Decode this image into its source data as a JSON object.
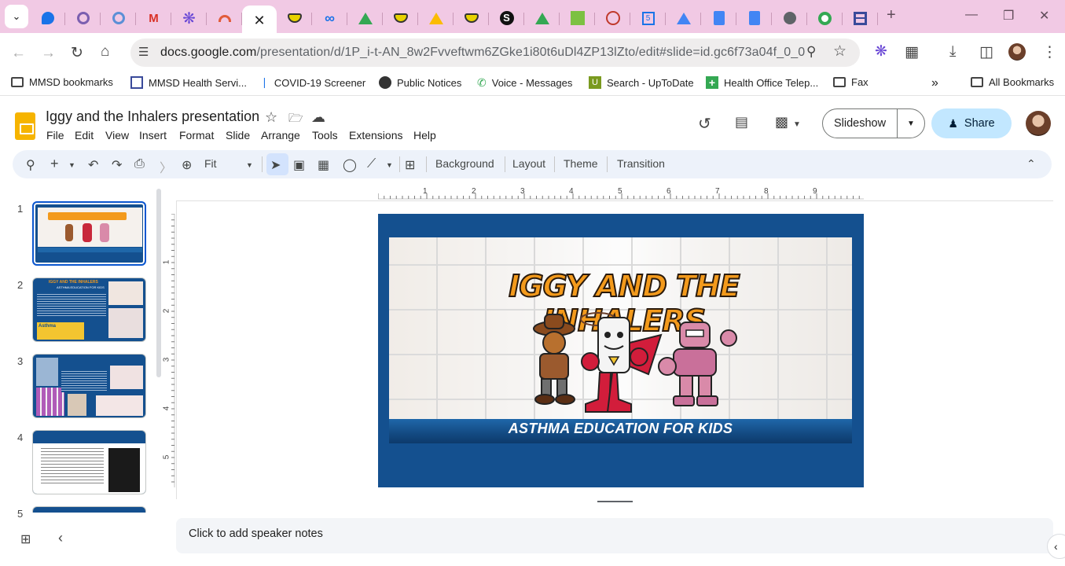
{
  "browser": {
    "tabs": [
      {
        "icon": "edge-blue-icon",
        "color": "#1a73e8"
      },
      {
        "icon": "target-icon",
        "color": "#7b5fb0"
      },
      {
        "icon": "target-icon",
        "color": "#5b8fd6"
      },
      {
        "icon": "gmail-icon",
        "color": "#d93025"
      },
      {
        "icon": "asterisk-icon",
        "color": "#6c4ad6"
      },
      {
        "icon": "rainbow-icon",
        "color": "#e25b3a"
      },
      {
        "icon": "close-icon",
        "color": "#1f1f1f",
        "active": true
      },
      {
        "icon": "mask-icon",
        "color": "#e8d200"
      },
      {
        "icon": "infinity-icon",
        "color": "#1a73e8"
      },
      {
        "icon": "drive-icon",
        "color": "#34a853"
      },
      {
        "icon": "mask-icon",
        "color": "#e8d200"
      },
      {
        "icon": "drive-icon",
        "color": "#34a853"
      },
      {
        "icon": "mask-icon",
        "color": "#e8d200"
      },
      {
        "icon": "s-icon",
        "color": "#1f1f1f"
      },
      {
        "icon": "drive-icon",
        "color": "#34a853"
      },
      {
        "icon": "green-square-icon",
        "color": "#7cc142"
      },
      {
        "icon": "crosshair-icon",
        "color": "#c0392b"
      },
      {
        "icon": "calendar-icon",
        "color": "#1a73e8"
      },
      {
        "icon": "drive-icon",
        "color": "#34a853"
      },
      {
        "icon": "docs-icon",
        "color": "#4285f4"
      },
      {
        "icon": "docs-icon",
        "color": "#4285f4"
      },
      {
        "icon": "globe-icon",
        "color": "#5f6368"
      },
      {
        "icon": "chrome-icon",
        "color": "#34a853"
      },
      {
        "icon": "table-icon",
        "color": "#3a4a9a"
      }
    ],
    "url_domain": "docs.google.com",
    "url_path": "/presentation/d/1P_i-t-AN_8w2Fvveftwm6ZGke1i80t6uDl4ZP13lZto/edit#slide=id.gc6f73a04f_0_0",
    "bookmarks": [
      {
        "label": "MMSD bookmarks",
        "icon": "folder-icon"
      },
      {
        "label": "MMSD Health Servi...",
        "icon": "calendar-icon"
      },
      {
        "label": "COVID-19 Screener",
        "icon": "pin-icon"
      },
      {
        "label": "Public Notices",
        "icon": "globe-icon"
      },
      {
        "label": "Voice - Messages",
        "icon": "phone-icon"
      },
      {
        "label": "Search - UpToDate",
        "icon": "uptodate-icon"
      },
      {
        "label": "Health Office Telep...",
        "icon": "plus-icon"
      },
      {
        "label": "Fax",
        "icon": "folder-icon"
      }
    ],
    "all_bookmarks": "All Bookmarks"
  },
  "doc": {
    "title": "Iggy and the Inhalers presentation",
    "menu": [
      "File",
      "Edit",
      "View",
      "Insert",
      "Format",
      "Slide",
      "Arrange",
      "Tools",
      "Extensions",
      "Help"
    ],
    "slideshow_label": "Slideshow",
    "share_label": "Share"
  },
  "toolbar": {
    "zoom": "Fit",
    "background": "Background",
    "layout": "Layout",
    "theme": "Theme",
    "transition": "Transition"
  },
  "filmstrip": {
    "slides": [
      "1",
      "2",
      "3",
      "4",
      "5"
    ]
  },
  "rulers": {
    "h": [
      "1",
      "2",
      "3",
      "4",
      "5",
      "6",
      "7",
      "8",
      "9"
    ],
    "v": [
      "1",
      "2",
      "3",
      "4",
      "5"
    ]
  },
  "slide": {
    "logo": "IGGY AND THE INHALERS",
    "banner": "ASTHMA EDUCATION FOR KIDS",
    "background_color": "#14508f",
    "logo_color": "#f39a1c"
  },
  "thumbs": {
    "t2_title": "IGGY AND THE INHALERS",
    "t2_sub": "ASTHMA EDUCATION FOR KIDS",
    "t2_box": "Asthma"
  },
  "notes": {
    "placeholder": "Click to add speaker notes"
  }
}
